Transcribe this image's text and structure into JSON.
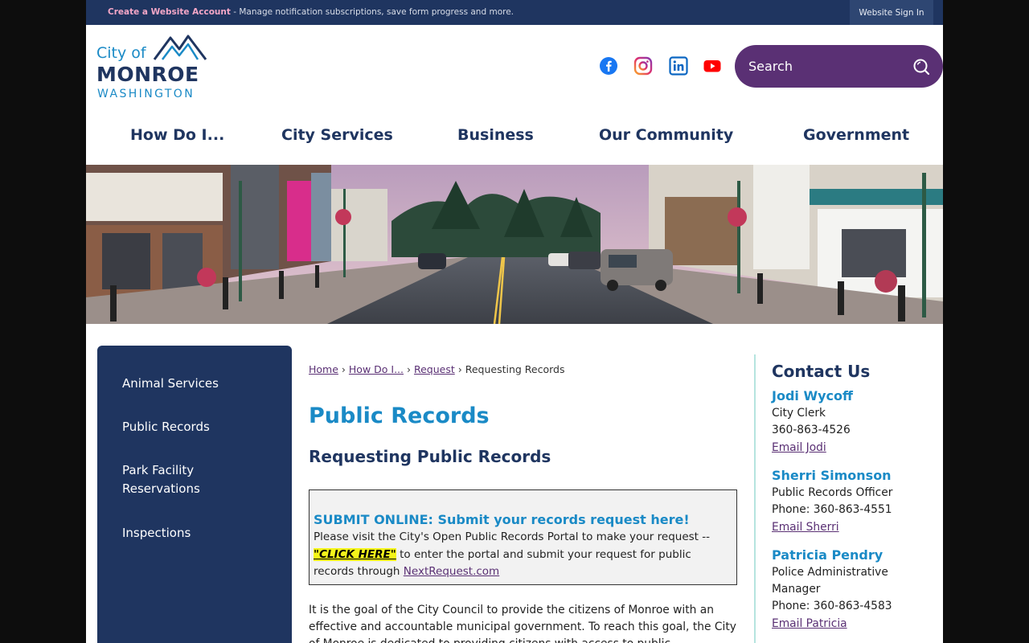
{
  "topbar": {
    "create_link": "Create a Website Account",
    "create_desc": " - Manage notification subscriptions, save form progress and more.",
    "signin": "Website Sign In"
  },
  "logo": {
    "city_of": "City of",
    "name": "MONROE",
    "state": "WASHINGTON"
  },
  "social": [
    "facebook-icon",
    "instagram-icon",
    "linkedin-icon",
    "youtube-icon"
  ],
  "search": {
    "placeholder": "Search"
  },
  "nav": [
    "How Do I...",
    "City Services",
    "Business",
    "Our Community",
    "Government"
  ],
  "sidebar": [
    "Animal Services",
    "Public Records",
    "Park Facility Reservations",
    "Inspections"
  ],
  "breadcrumb": {
    "home": "Home",
    "how": "How Do I...",
    "request": "Request",
    "current": "Requesting Records",
    "sep": "›"
  },
  "main": {
    "title": "Public Records",
    "subtitle": "Requesting Public Records",
    "callout_heading": "SUBMIT ONLINE: Submit your records request here!",
    "callout_text1": "Please visit the City's Open Public Records Portal to make your request --",
    "callout_click": "\"CLICK HERE\"",
    "callout_text2": " to enter the portal and submit your request for public records through ",
    "callout_link": "NextRequest.com",
    "body": "It is the goal of the City Council to provide the citizens of Monroe with an effective and accountable municipal government. To reach this goal, the City of Monroe is dedicated to providing citizens with access to public"
  },
  "contact": {
    "heading": "Contact Us",
    "people": [
      {
        "name": "Jodi Wycoff",
        "line1": "City Clerk",
        "line2": "360-863-4526",
        "email": "Email Jodi"
      },
      {
        "name": "Sherri Simonson",
        "line1": "Public Records Officer",
        "line2": "Phone: 360-863-4551",
        "email": "Email Sherri"
      },
      {
        "name": "Patricia Pendry",
        "line1": "Police Administrative Manager",
        "line2": "Phone: 360-863-4583",
        "email": "Email Patricia"
      }
    ]
  },
  "colors": {
    "navy": "#1f3560",
    "blue": "#1a8ac6",
    "purple": "#5a3074",
    "highlight": "#f5f51a"
  }
}
